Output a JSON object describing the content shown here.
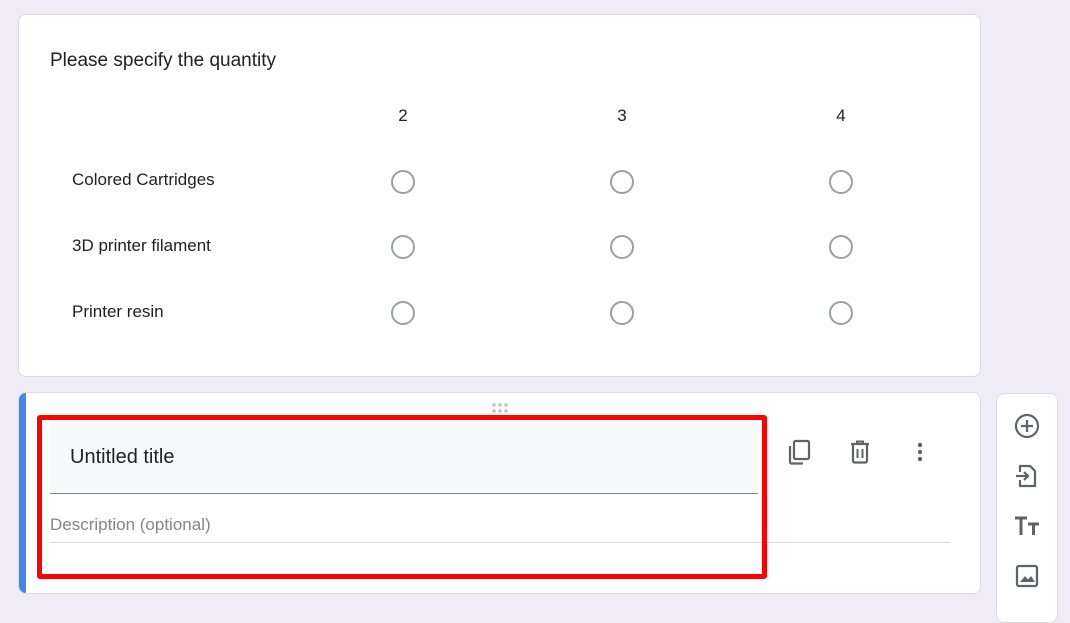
{
  "grid_question": {
    "title": "Please specify the quantity",
    "columns": [
      "2",
      "3",
      "4"
    ],
    "rows": [
      "Colored Cartridges",
      "3D printer filament",
      "Printer resin"
    ]
  },
  "edit_question": {
    "title_value": "Untitled title",
    "description_placeholder": "Description (optional)"
  },
  "icons": {
    "drag": "drag-handle-icon",
    "duplicate": "copy-icon",
    "delete": "trash-icon",
    "more": "more-vert-icon",
    "add_question": "add-circle-icon",
    "import_questions": "import-icon",
    "add_title": "text-title-icon",
    "add_image": "image-icon"
  },
  "colors": {
    "accent": "#4285f4",
    "highlight": "#ff0000",
    "background": "#efecf7"
  }
}
